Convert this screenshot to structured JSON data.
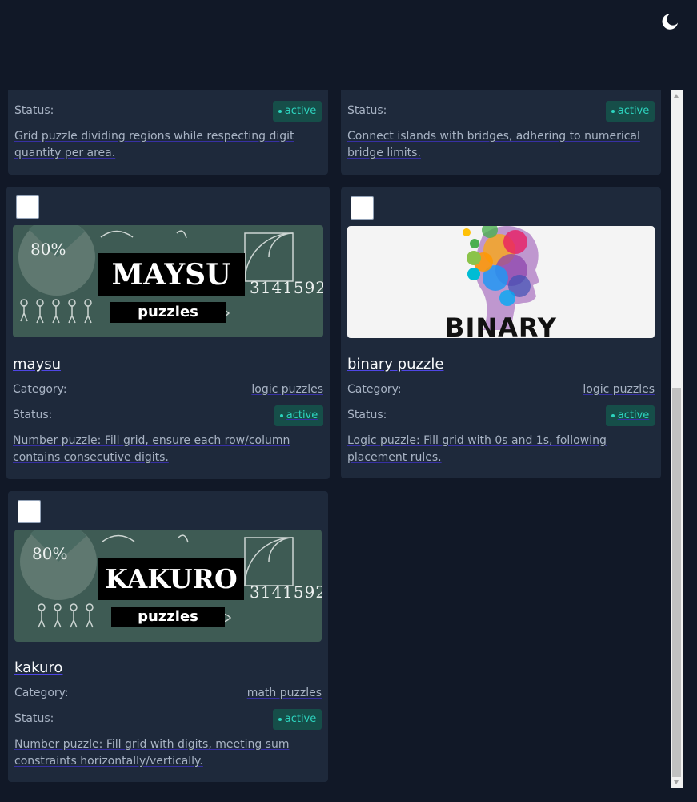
{
  "labels": {
    "category": "Category:",
    "status": "Status:"
  },
  "cards_top_partial": [
    {
      "status": "active",
      "description": "Grid puzzle dividing regions while respecting digit quantity per area."
    },
    {
      "status": "active",
      "description": "Connect islands with bridges, adhering to numerical bridge limits."
    }
  ],
  "cards": [
    {
      "title": "maysu",
      "category": "logic puzzles",
      "status": "active",
      "description": "Number puzzle: Fill grid, ensure each row/column contains consecutive digits.",
      "logo_text": "MAYSU",
      "logo_sub": "puzzles",
      "chalk_numbers": "3141592",
      "chalk_percent": "80%"
    },
    {
      "title": "binary puzzle",
      "category": "logic puzzles",
      "status": "active",
      "description": "Logic puzzle: Fill grid with 0s and 1s, following placement rules.",
      "logo_text": "BINARY"
    },
    {
      "title": "kakuro",
      "category": "math puzzles",
      "status": "active",
      "description": "Number puzzle: Fill grid with digits, meeting sum constraints horizontally/vertically.",
      "logo_text": "KAKURO",
      "logo_sub": "puzzles",
      "chalk_numbers": "3141592",
      "chalk_percent": "80%"
    }
  ],
  "colors": {
    "background": "#111827",
    "card": "#1e293b",
    "badge_bg": "#164e49",
    "badge_text": "#2dd4bf",
    "accent_underline": "#4f46e5"
  }
}
